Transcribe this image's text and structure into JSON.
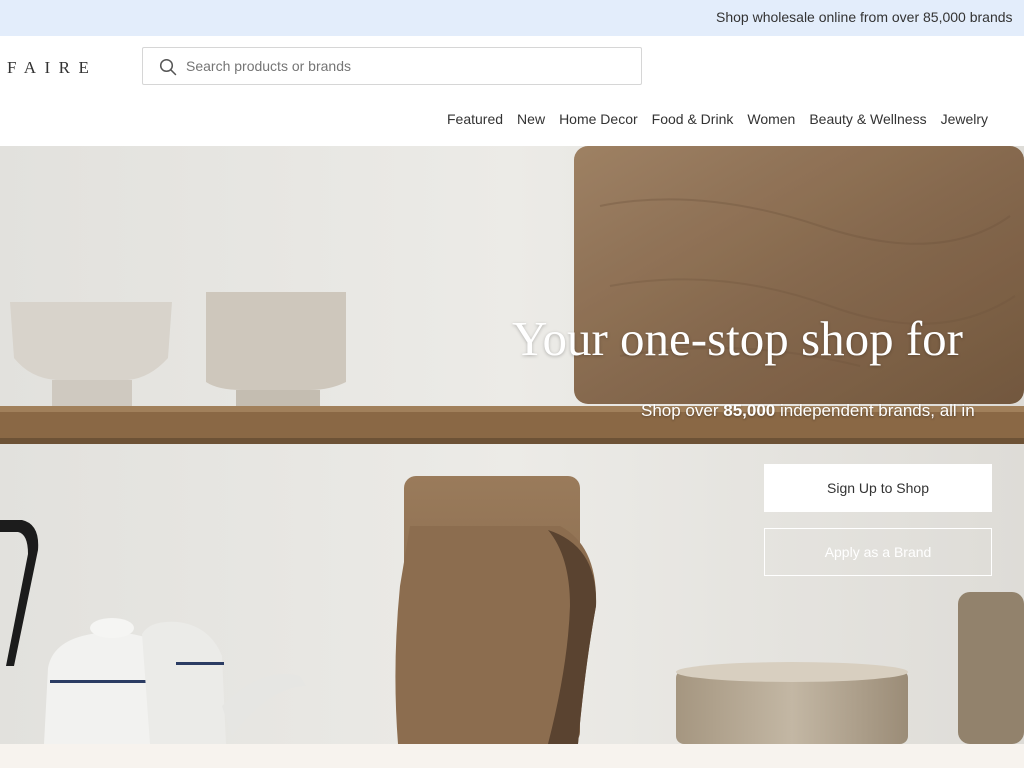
{
  "announcement": {
    "text": "Shop wholesale online from over 85,000 brands"
  },
  "header": {
    "logo": "FAIRE",
    "search": {
      "placeholder": "Search products or brands",
      "value": ""
    }
  },
  "nav": {
    "items": [
      {
        "label": "Featured"
      },
      {
        "label": "New"
      },
      {
        "label": "Home Decor"
      },
      {
        "label": "Food & Drink"
      },
      {
        "label": "Women"
      },
      {
        "label": "Beauty & Wellness"
      },
      {
        "label": "Jewelry"
      }
    ]
  },
  "hero": {
    "title": "Your one-stop shop for",
    "subtitle_prefix": "Shop over ",
    "subtitle_count": "85,000",
    "subtitle_suffix": " independent brands, all in",
    "primary_cta": "Sign Up to Shop",
    "secondary_cta": "Apply as a Brand"
  },
  "colors": {
    "announcement_bg": "#e3edfb",
    "text": "#333333",
    "hero_wall": "#e8e7e3",
    "shelf_wood": "#8a6845",
    "footer_strip": "#f7f3ee"
  }
}
